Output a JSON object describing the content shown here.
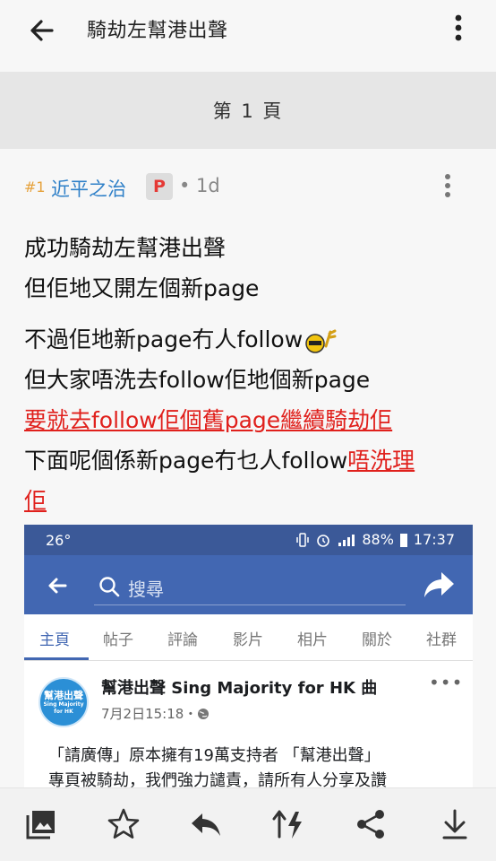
{
  "topbar": {
    "title": "騎劫左幫港出聲"
  },
  "page_band": {
    "label": "第 1 頁"
  },
  "post": {
    "floor": "#1",
    "author": "近平之治",
    "badge": "P",
    "time": "• 1d",
    "lines": {
      "l1": "成功騎劫左幫港出聲",
      "l2": "但佢地又開左個新page",
      "l3": "不過佢地新page冇人follow",
      "l4": "但大家唔洗去follow佢地個新page",
      "l5_red": "要就去follow佢個舊page繼續騎劫佢",
      "l6": "下面呢個係新page冇乜人follow",
      "l6_red": "唔洗理",
      "l7_red": "佢"
    }
  },
  "embed": {
    "status": {
      "temp": "26°",
      "battery": "88%",
      "clock": "17:37"
    },
    "search_placeholder": "搜尋",
    "tabs": [
      "主頁",
      "帖子",
      "評論",
      "影片",
      "相片",
      "關於",
      "社群"
    ],
    "fb_post": {
      "avatar_text": "幫港出聲",
      "avatar_subtext": "Sing Majority for HK",
      "page_name": "幫港出聲 Sing Majority for HK 曲",
      "date": "7月2日15:18・",
      "text_line1": "「請廣傳」原本擁有19萬支持者 「幫港出聲」",
      "text_line2": "專頁被騎劫，我們強力譴責，請所有人分享及讚"
    }
  },
  "icons": {
    "back": "arrow-left-icon",
    "more": "more-vertical-icon",
    "gallery": "image-gallery-icon",
    "star": "star-icon",
    "reply": "reply-icon",
    "sort": "sort-flash-icon",
    "share": "share-icon",
    "download": "download-icon"
  },
  "colors": {
    "author_blue": "#2f80c8",
    "floor_orange": "#e6a23c",
    "highlight_red": "#e0201c",
    "fb_blue": "#4267b2"
  }
}
